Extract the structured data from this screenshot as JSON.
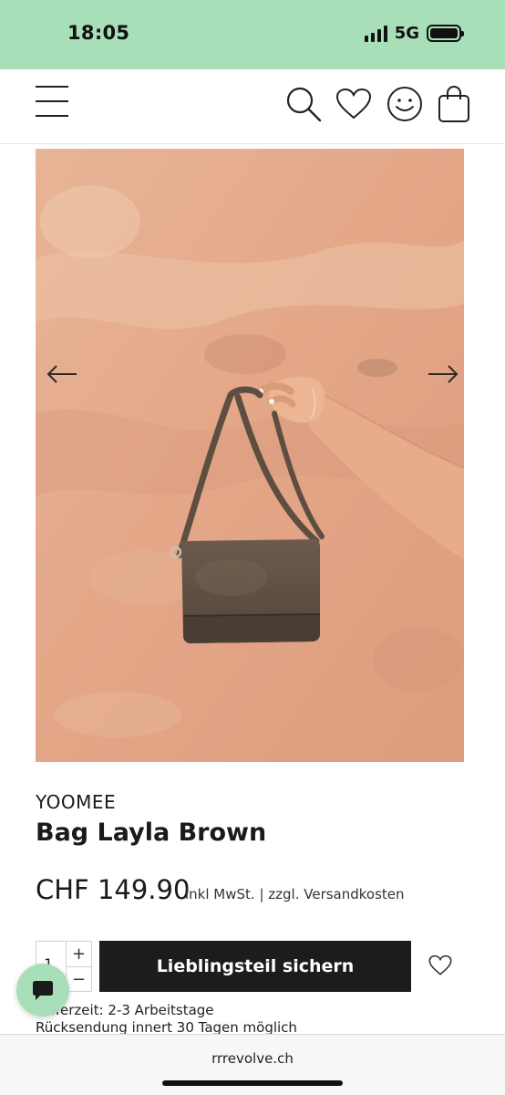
{
  "status_bar": {
    "time": "18:05",
    "network": "5G",
    "battery": 1.0
  },
  "header": {
    "icons": [
      "menu-icon",
      "search-icon",
      "heart-icon",
      "smiley-icon",
      "shopping-bag-icon"
    ]
  },
  "product": {
    "brand": "YOOMEE",
    "title": "Bag Layla Brown",
    "price": "CHF 149.90",
    "price_note": "inkl MwSt. | zzgl. Versandkosten",
    "quantity": "1",
    "quantity_plus": "+",
    "quantity_minus": "−",
    "cta_label": "Lieblingsteil sichern",
    "delivery": "Lieferzeit: 2-3 Arbeitstage",
    "returns": "Rücksendung innert 30 Tagen möglich"
  },
  "browser": {
    "url": "rrrevolve.ch"
  },
  "colors": {
    "accent_green": "#a8dfb9",
    "cta_background": "#1c1c1c"
  }
}
